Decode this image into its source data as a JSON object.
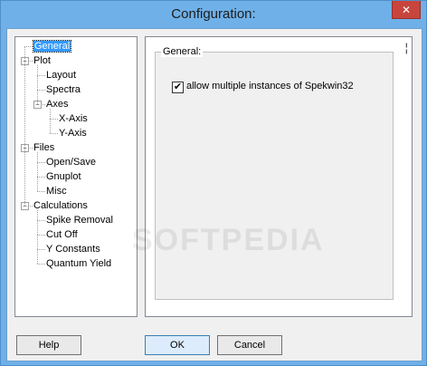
{
  "window": {
    "title": "Configuration:",
    "close_label": "✕"
  },
  "tree": {
    "items": [
      {
        "label": "General",
        "level": 0,
        "expander": "",
        "selected": true
      },
      {
        "label": "Plot",
        "level": 0,
        "expander": "−"
      },
      {
        "label": "Layout",
        "level": 1
      },
      {
        "label": "Spectra",
        "level": 1
      },
      {
        "label": "Axes",
        "level": 1,
        "expander": "−"
      },
      {
        "label": "X-Axis",
        "level": 2
      },
      {
        "label": "Y-Axis",
        "level": 2
      },
      {
        "label": "Files",
        "level": 0,
        "expander": "−"
      },
      {
        "label": "Open/Save",
        "level": 1
      },
      {
        "label": "Gnuplot",
        "level": 1
      },
      {
        "label": "Misc",
        "level": 1
      },
      {
        "label": "Calculations",
        "level": 0,
        "expander": "−"
      },
      {
        "label": "Spike Removal",
        "level": 1
      },
      {
        "label": "Cut Off",
        "level": 1
      },
      {
        "label": "Y Constants",
        "level": 1
      },
      {
        "label": "Quantum Yield",
        "level": 1
      }
    ]
  },
  "panel": {
    "group_title": "General:",
    "checkbox_label": "allow multiple instances of Spekwin32",
    "checkbox_checked": true,
    "scroll_marker": "¦"
  },
  "buttons": {
    "help": "Help",
    "ok": "OK",
    "cancel": "Cancel"
  },
  "watermark": "SOFTPEDIA",
  "colors": {
    "titlebar": "#6fb0e8",
    "close": "#c7453c",
    "selection": "#3399ff"
  }
}
